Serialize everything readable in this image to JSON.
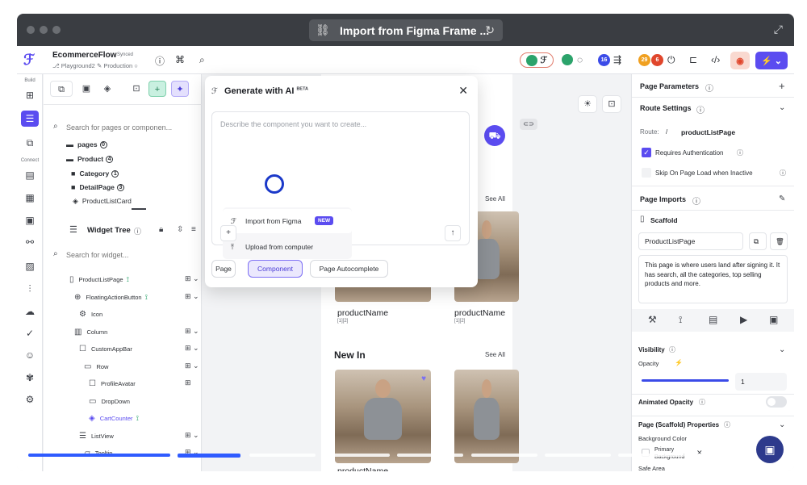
{
  "browser": {
    "title": "Import from Figma Frame ..."
  },
  "topbar": {
    "project_name": "EcommerceFlow",
    "synced": "Synced",
    "branch": "Playground2",
    "environment": "Production",
    "badge_16": "16",
    "badge_29": "29",
    "badge_6": "6"
  },
  "rail": {
    "build_label": "Build",
    "connect_label": "Connect"
  },
  "leftpanel": {
    "search_placeholder": "Search for pages or componen...",
    "pages_folder": "pages",
    "pages_count": "0",
    "product_folder": "Product",
    "product_count": "4",
    "category_folder": "Category",
    "category_count": "1",
    "detail_folder": "DetailPage",
    "detail_count": "3",
    "product_list_card": "ProductListCard",
    "widget_tree_title": "Widget Tree",
    "widget_search_placeholder": "Search for widget...",
    "widgets": [
      "ProductListPage",
      "FloatingActionButton",
      "Icon",
      "Column",
      "CustomAppBar",
      "Row",
      "ProfileAvatar",
      "DropDown",
      "CartCounter",
      "ListView",
      "Tooltip"
    ]
  },
  "modal": {
    "title": "Generate with AI",
    "beta": "BETA",
    "placeholder": "Describe the component you want to create...",
    "menu_import": "Import from Figma",
    "menu_new": "NEW",
    "menu_upload": "Upload from computer",
    "chip_page": "Page",
    "chip_component": "Component",
    "chip_autocomplete": "Page Autocomplete"
  },
  "canvas": {
    "see_all_1": "See All",
    "product_name": "productName",
    "product_index": "[1][2]",
    "new_in": "New In",
    "see_all_2": "See All"
  },
  "rightpanel": {
    "page_parameters": "Page Parameters",
    "route_settings": "Route Settings",
    "route_label": "Route:",
    "route_slash": "/",
    "route_value": "productListPage",
    "requires_auth": "Requires Authentication",
    "skip_on_load": "Skip On Page Load when Inactive",
    "page_imports": "Page Imports",
    "scaffold": "Scaffold",
    "page_name": "ProductListPage",
    "description": "This page is where users land after signing it. It has search, all the categories, top selling products and more.",
    "visibility": "Visibility",
    "opacity": "Opacity",
    "opacity_value": "1",
    "animated_opacity": "Animated Opacity",
    "scaffold_props": "Page (Scaffold) Properties",
    "background_color": "Background Color",
    "bg_value": "Primary Background",
    "safe_area": "Safe Area"
  },
  "colors": {
    "accent": "#5b4cf0",
    "progress": "#2f5bff"
  }
}
